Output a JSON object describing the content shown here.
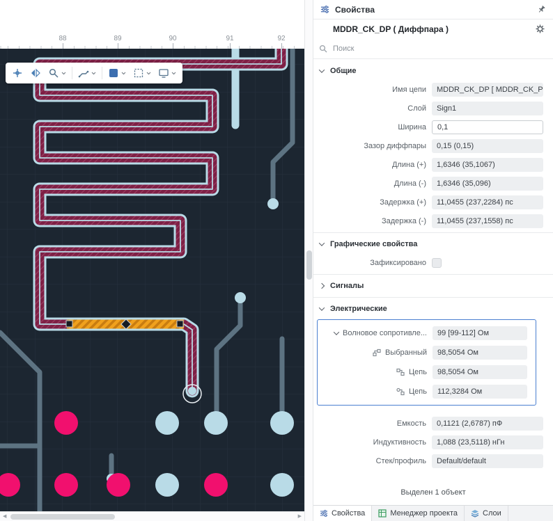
{
  "colors": {
    "canvas_bg": "#1c2631",
    "grid": "#27313e",
    "pad_pink": "#f1106e",
    "pad_blue": "#b9dbe7",
    "trace_maroon": "#7e2045",
    "trace_gray": "#5d7382",
    "selection_orange": "#f0a11d",
    "accent_blue": "#4a7fd0"
  },
  "ruler": {
    "marks": [
      "88",
      "89",
      "90",
      "91",
      "92"
    ]
  },
  "icons": {
    "pan-tool-icon": "crosshair",
    "mirror-icon": "mirror-triangles",
    "zoom-icon": "magnifier",
    "route-icon": "trace-route",
    "active-layer-icon": "blue-square",
    "selection-filter-icon": "dashed-square",
    "display-options-icon": "monitor",
    "properties-icon": "sliders",
    "pin-icon": "pushpin",
    "gear-icon": "gear",
    "search-icon": "magnifier",
    "project-manager-icon": "green-grid",
    "layers-icon": "stacked-layers"
  },
  "scrollbar": {
    "left_arrow": "◀",
    "right_arrow": "▶"
  },
  "panel": {
    "title": "Свойства",
    "object_title": "MDDR_CK_DP ( Диффпара )",
    "search_placeholder": "Поиск",
    "sections": {
      "general": {
        "label": "Общие",
        "rows": [
          {
            "label": "Имя цепи",
            "value": "MDDR_CK_DP [ MDDR_CK_P ..."
          },
          {
            "label": "Слой",
            "value": "Sign1"
          },
          {
            "label": "Ширина",
            "value": "0,1"
          },
          {
            "label": "Зазор диффпары",
            "value": "0,15 (0,15)"
          },
          {
            "label": "Длина (+)",
            "value": "1,6346 (35,1067)"
          },
          {
            "label": "Длина (-)",
            "value": "1,6346 (35,096)"
          },
          {
            "label": "Задержка (+)",
            "value": "11,0455 (237,2284) пс"
          },
          {
            "label": "Задержка (-)",
            "value": "11,0455 (237,1558) пс"
          }
        ]
      },
      "graphic": {
        "label": "Графические свойства",
        "rows": [
          {
            "label": "Зафиксировано",
            "type": "checkbox",
            "checked": false
          }
        ]
      },
      "signals": {
        "label": "Сигналы"
      },
      "electrical": {
        "label": "Электрические",
        "impedance_group": {
          "rows": [
            {
              "label": "Волновое сопротивле...",
              "value": "99 [99-112] Ом"
            },
            {
              "label": "Выбранный",
              "value": "98,5054 Ом"
            },
            {
              "label": "Цепь",
              "value": "98,5054 Ом"
            },
            {
              "label": "Цепь",
              "value": "112,3284 Ом"
            }
          ]
        },
        "rows": [
          {
            "label": "Емкость",
            "value": "0,1121 (2,6787) пФ"
          },
          {
            "label": "Индуктивность",
            "value": "1,088 (23,5118) нГн"
          },
          {
            "label": "Стек/профиль",
            "value": "Default/default"
          }
        ]
      }
    },
    "status": "Выделен 1 объект",
    "tabs": [
      {
        "label": "Свойства",
        "active": true
      },
      {
        "label": "Менеджер проекта",
        "active": false
      },
      {
        "label": "Слои",
        "active": false
      }
    ]
  }
}
